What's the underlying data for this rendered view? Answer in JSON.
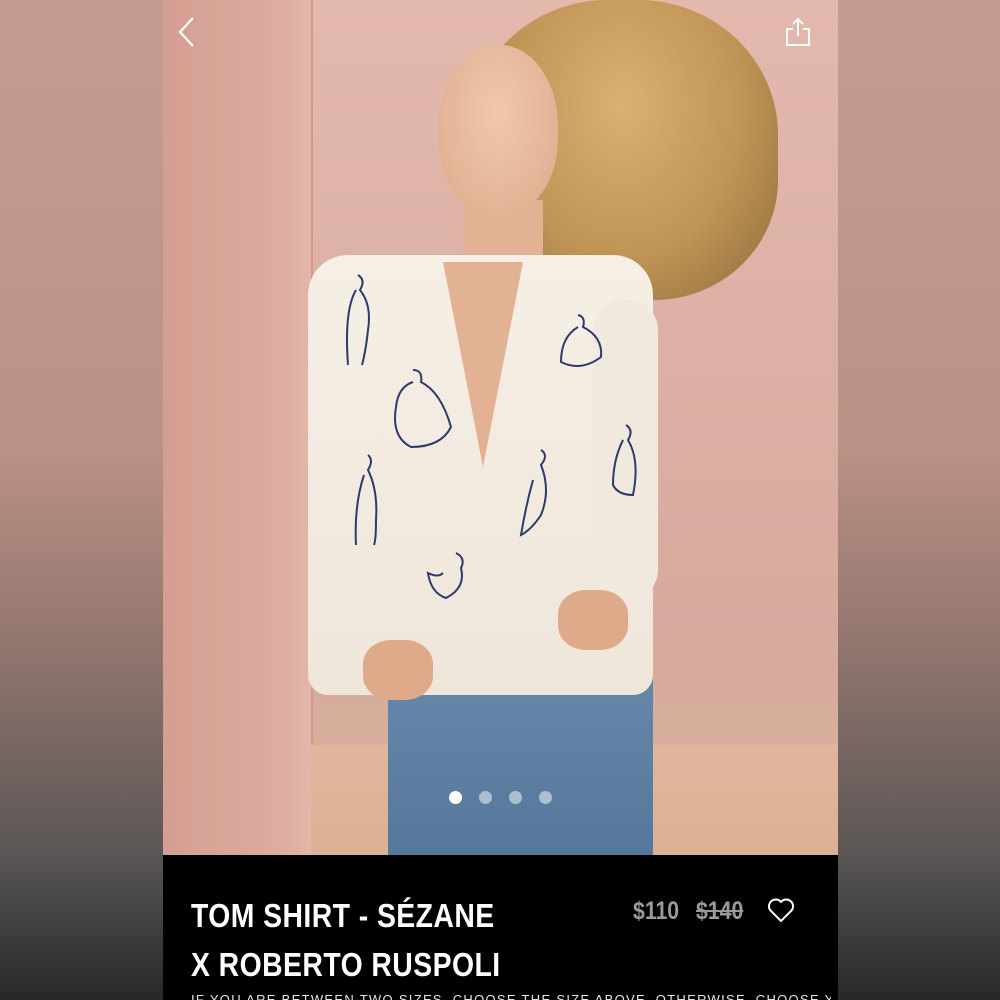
{
  "header": {
    "back_icon": "chevron-left-icon",
    "share_icon": "share-icon"
  },
  "carousel": {
    "total_images": 4,
    "active_index": 0
  },
  "product": {
    "title": "TOM SHIRT - SÉZANE X ROBERTO RUSPOLI",
    "price_current": "$110",
    "price_original": "$140",
    "favorite_icon": "heart-outline-icon",
    "size_advice": "IF YOU ARE BETWEEN TWO SIZES, CHOOSE THE SIZE ABOVE. OTHERWISE, CHOOSE YOUR"
  },
  "colors": {
    "panel_bg": "#000000",
    "price_text": "#9a9a9a",
    "title_text": "#ffffff"
  }
}
